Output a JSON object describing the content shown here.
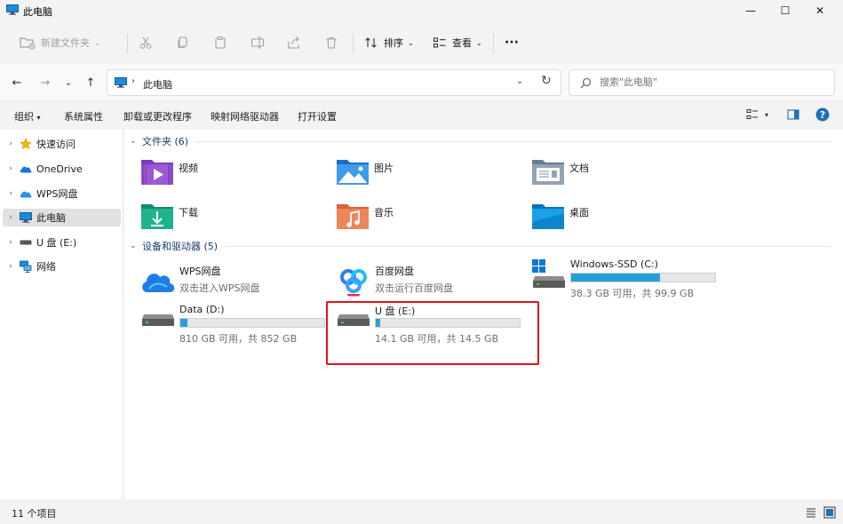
{
  "window": {
    "title": "此电脑",
    "controls": {
      "minimize": "—",
      "maximize": "☐",
      "close": "✕"
    }
  },
  "toolbar": {
    "new_folder": "新建文件夹",
    "sort": "排序",
    "view": "查看",
    "more": "···"
  },
  "nav": {
    "back": "←",
    "forward": "→",
    "recent": "⌄",
    "up": "↑",
    "breadcrumb_sep": "›",
    "breadcrumb": "此电脑",
    "address_dropdown": "⌄",
    "refresh": "↻",
    "search_placeholder": "搜索\"此电脑\""
  },
  "ribbon": {
    "organize": "组织",
    "system_properties": "系统属性",
    "uninstall": "卸载或更改程序",
    "map_drive": "映射网络驱动器",
    "open_settings": "打开设置"
  },
  "sidebar": {
    "items": [
      {
        "label": "快速访问",
        "icon": "star-icon"
      },
      {
        "label": "OneDrive",
        "icon": "cloud-icon"
      },
      {
        "label": "WPS网盘",
        "icon": "wps-cloud-icon"
      },
      {
        "label": "此电脑",
        "icon": "computer-icon",
        "selected": true
      },
      {
        "label": "U 盘 (E:)",
        "icon": "usb-drive-icon"
      },
      {
        "label": "网络",
        "icon": "network-icon"
      }
    ]
  },
  "groups": {
    "folders": {
      "header": "文件夹 (6)",
      "items": [
        {
          "label": "视频",
          "icon": "video-folder-icon"
        },
        {
          "label": "图片",
          "icon": "pictures-folder-icon"
        },
        {
          "label": "文档",
          "icon": "documents-folder-icon"
        },
        {
          "label": "下载",
          "icon": "downloads-folder-icon"
        },
        {
          "label": "音乐",
          "icon": "music-folder-icon"
        },
        {
          "label": "桌面",
          "icon": "desktop-folder-icon"
        }
      ]
    },
    "devices": {
      "header": "设备和驱动器 (5)",
      "wps": {
        "name": "WPS网盘",
        "sub": "双击进入WPS网盘"
      },
      "baidu": {
        "name": "百度网盘",
        "sub": "双击运行百度网盘"
      },
      "drive_c": {
        "name": "Windows-SSD (C:)",
        "free": "38.3 GB 可用，共 99.9 GB",
        "used_fraction": 0.617
      },
      "drive_d": {
        "name": "Data (D:)",
        "free": "810 GB 可用，共 852 GB",
        "used_fraction": 0.049
      },
      "drive_e": {
        "name": "U 盘 (E:)",
        "free": "14.1 GB 可用，共 14.5 GB",
        "used_fraction": 0.028
      }
    }
  },
  "status": {
    "count": "11 个项目"
  },
  "colors": {
    "accent": "#26a0da",
    "highlight": "#e0131b"
  }
}
